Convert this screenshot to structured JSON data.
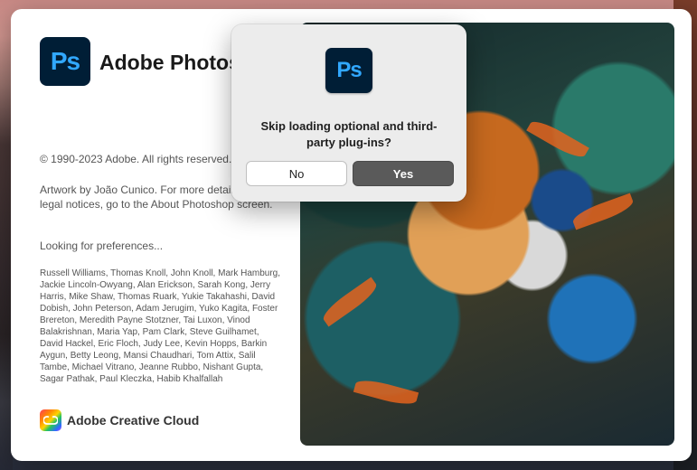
{
  "splash": {
    "app_logo_text": "Ps",
    "app_title": "Adobe Photoshop",
    "copyright": "© 1990-2023 Adobe. All rights reserved.",
    "artwork_credit": "Artwork by João Cunico. For more details and legal notices, go to the About Photoshop screen.",
    "status": "Looking for preferences...",
    "credits": "Russell Williams, Thomas Knoll, John Knoll, Mark Hamburg, Jackie Lincoln-Owyang, Alan Erickson, Sarah Kong, Jerry Harris, Mike Shaw, Thomas Ruark, Yukie Takahashi, David Dobish, John Peterson, Adam Jerugim, Yuko Kagita, Foster Brereton, Meredith Payne Stotzner, Tai Luxon, Vinod Balakrishnan, Maria Yap, Pam Clark, Steve Guilhamet, David Hackel, Eric Floch, Judy Lee, Kevin Hopps, Barkin Aygun, Betty Leong, Mansi Chaudhari, Tom Attix, Salil Tambe, Michael Vitrano, Jeanne Rubbo, Nishant Gupta, Sagar Pathak, Paul Kleczka, Habib Khalfallah",
    "cc_label": "Adobe Creative Cloud"
  },
  "dialog": {
    "icon_text": "Ps",
    "message": "Skip loading optional and third-party plug-ins?",
    "no_label": "No",
    "yes_label": "Yes"
  },
  "colors": {
    "ps_bg": "#001e36",
    "ps_fg": "#31a8ff",
    "primary_button": "#5a5a5a"
  }
}
